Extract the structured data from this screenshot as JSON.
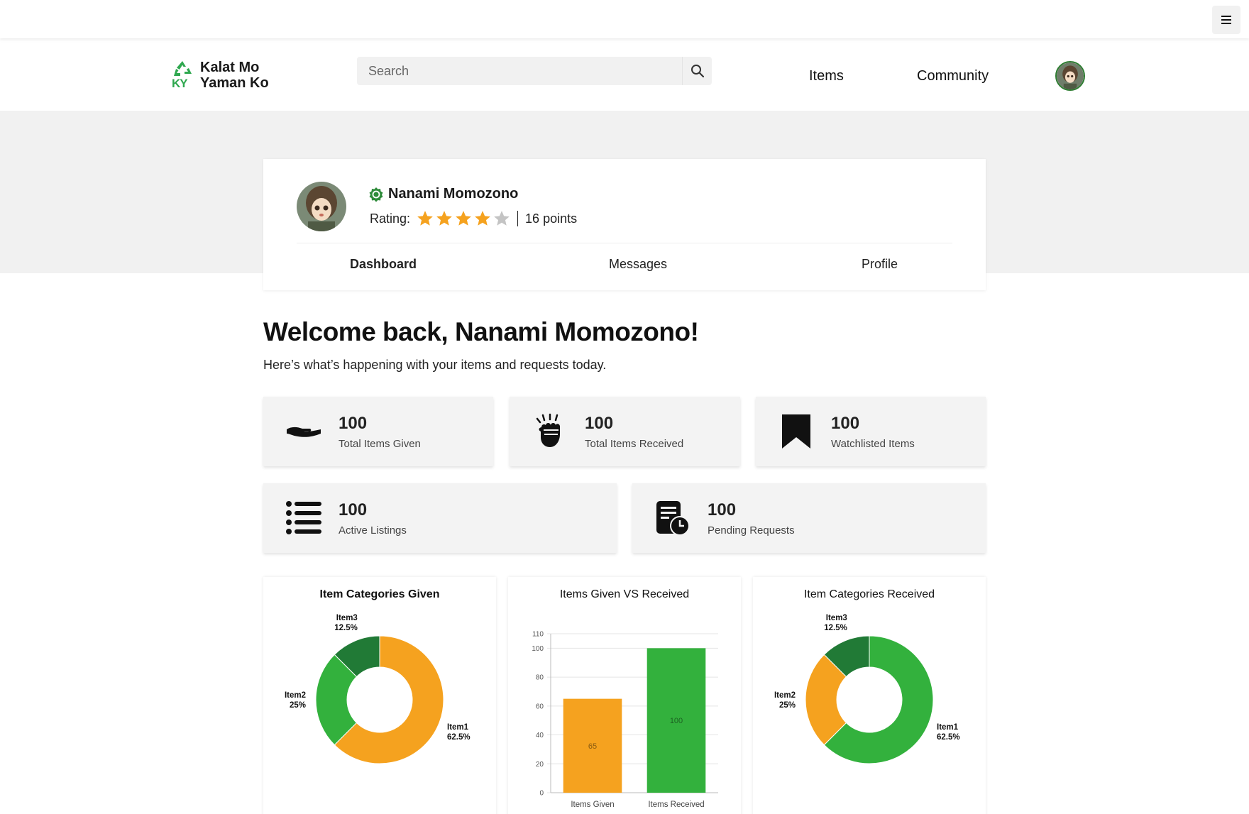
{
  "header": {
    "brand_line1": "Kalat Mo",
    "brand_line2": "Yaman Ko",
    "brand_initials": "KY",
    "search_placeholder": "Search",
    "nav_items": "Items",
    "nav_community": "Community"
  },
  "profile": {
    "name": "Nanami Momozono",
    "rating_label": "Rating:",
    "rating_stars": 4,
    "rating_max": 5,
    "points": "16 points",
    "tabs": [
      "Dashboard",
      "Messages",
      "Profile"
    ]
  },
  "welcome": {
    "title": "Welcome back, Nanami Momozono!",
    "subtitle": "Here’s what’s happening with your items and requests today."
  },
  "stats": [
    {
      "value": "100",
      "label": "Total Items Given",
      "icon": "hand-give-icon"
    },
    {
      "value": "100",
      "label": "Total Items Received",
      "icon": "fist-receive-icon"
    },
    {
      "value": "100",
      "label": "Watchlisted Items",
      "icon": "bookmark-icon"
    },
    {
      "value": "100",
      "label": "Active Listings",
      "icon": "list-icon"
    },
    {
      "value": "100",
      "label": "Pending Requests",
      "icon": "pending-document-icon"
    }
  ],
  "colors": {
    "orange": "#f5a21f",
    "green": "#33b13d",
    "dark_green": "#217a36",
    "star_on": "#f5a21f",
    "star_off": "#c4c4c4",
    "brand_green": "#2e7d32"
  },
  "chart_data": [
    {
      "type": "pie",
      "title": "Item Categories Given",
      "categories": [
        "Item1",
        "Item2",
        "Item3"
      ],
      "values": [
        62.5,
        25,
        12.5
      ],
      "labels": [
        "62.5%",
        "25%",
        "12.5%"
      ],
      "colors": [
        "#f5a21f",
        "#33b13d",
        "#217a36"
      ]
    },
    {
      "type": "bar",
      "title": "Items Given VS Received",
      "categories": [
        "Items Given",
        "Items Received"
      ],
      "values": [
        65,
        100
      ],
      "colors": [
        "#f5a21f",
        "#33b13d"
      ],
      "ylim": [
        0,
        110
      ],
      "yticks": [
        0,
        20,
        40,
        60,
        80,
        100,
        110
      ],
      "grid": true
    },
    {
      "type": "pie",
      "title": "Item Categories Received",
      "categories": [
        "Item1",
        "Item2",
        "Item3"
      ],
      "values": [
        62.5,
        25,
        12.5
      ],
      "labels": [
        "62.5%",
        "25%",
        "12.5%"
      ],
      "colors": [
        "#33b13d",
        "#f5a21f",
        "#217a36"
      ]
    }
  ]
}
